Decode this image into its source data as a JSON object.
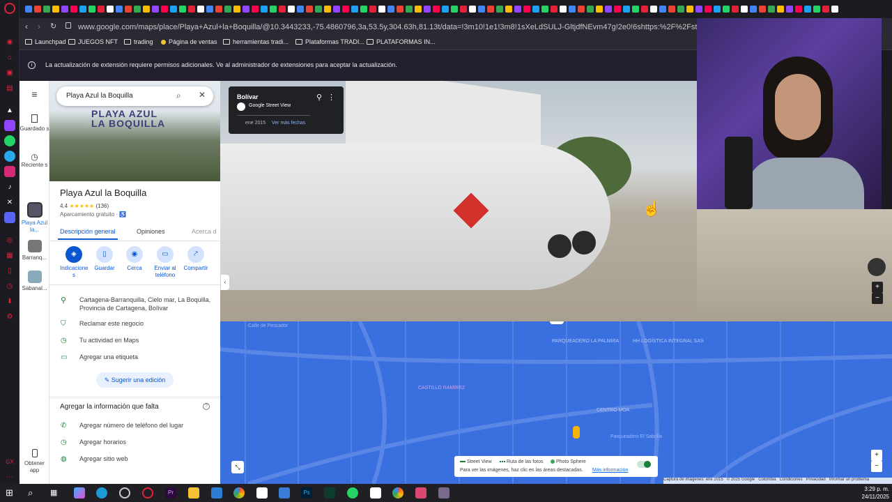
{
  "browser": {
    "url": "www.google.com/maps/place/Playa+Azul+la+Boquilla/@10.3443233,-75.4860796,3a,53.5y,304.63h,81.13t/data=!3m10!1e1!3m8!1sXeLdSULJ-GltjdfNEvm47g!2e0!6shttps:%2F%2Fstreetviewpixels-pa.googleapis.cc",
    "bookmarks": [
      "Launchpad",
      "JUEGOS NFT",
      "trading",
      "Página de ventas",
      "herramientas tradi...",
      "Plataformas TRADI...",
      "PLATAFORMAS IN..."
    ]
  },
  "infobar": {
    "message": "La actualización de extensión requiere permisos adicionales. Ve al administrador de extensiones para aceptar la actualización."
  },
  "maps_nav": {
    "saved": "Guardado s",
    "recent": "Reciente s",
    "recent_items": [
      "Playa Azul la...",
      "Barranq...",
      "Sabanal..."
    ],
    "get_app": "Obtener app"
  },
  "place": {
    "search_value": "Playa Azul la Boquilla",
    "hero_sign": "PLAYA AZUL LA BOQUILLA",
    "name": "Playa Azul la Boquilla",
    "rating": "4.4",
    "stars": "★★★★★",
    "reviews": "(136)",
    "parking": "Aparcamiento gratuito ·",
    "tabs": [
      "Descripción general",
      "Opiniones",
      "Acerca d"
    ],
    "actions": [
      "Indicacione s",
      "Guardar",
      "Cerca",
      "Enviar al teléfono",
      "Compartir"
    ],
    "address": "Cartagena-Barranquilla, Cielo mar, La Boquilla, Provincia de Cartagena, Bolívar",
    "claim": "Reclamar este negocio",
    "activity": "Tu actividad en Maps",
    "label": "Agregar una etiqueta",
    "suggest": "Sugerir una edición",
    "missing_title": "Agregar la información que falta",
    "add_phone": "Agregar número de teléfono del lugar",
    "add_hours": "Agregar horarios",
    "add_web": "Agregar sitio web"
  },
  "streetview": {
    "location": "Bolívar",
    "source": "Google Street View",
    "date": "ene 2015",
    "more_dates": "Ver más fechas"
  },
  "map": {
    "labels": [
      "PARQUEADERO LA PALMIRA",
      "HH LOGÍSTICA INTEGRAL SAS",
      "CASTILLO RAMÍREZ",
      "CENTRO MOA",
      "Calle de Pescador",
      "Parqueadero El Sabrilla"
    ],
    "legend": {
      "street_view": "Street View",
      "photo_route": "Ruta de las fotos",
      "photo_sphere": "Photo Sphere",
      "hint": "Para ver las imágenes, haz clic en las áreas destacadas.",
      "more": "Más información"
    },
    "footer": [
      "Captura de imágenes: ene 2015",
      "© 2025 Google",
      "Colombia",
      "Condiciones",
      "Privacidad",
      "Informar un problema"
    ]
  },
  "taskbar": {
    "time": "3:29 p. m.",
    "date": "24/11/2025"
  }
}
